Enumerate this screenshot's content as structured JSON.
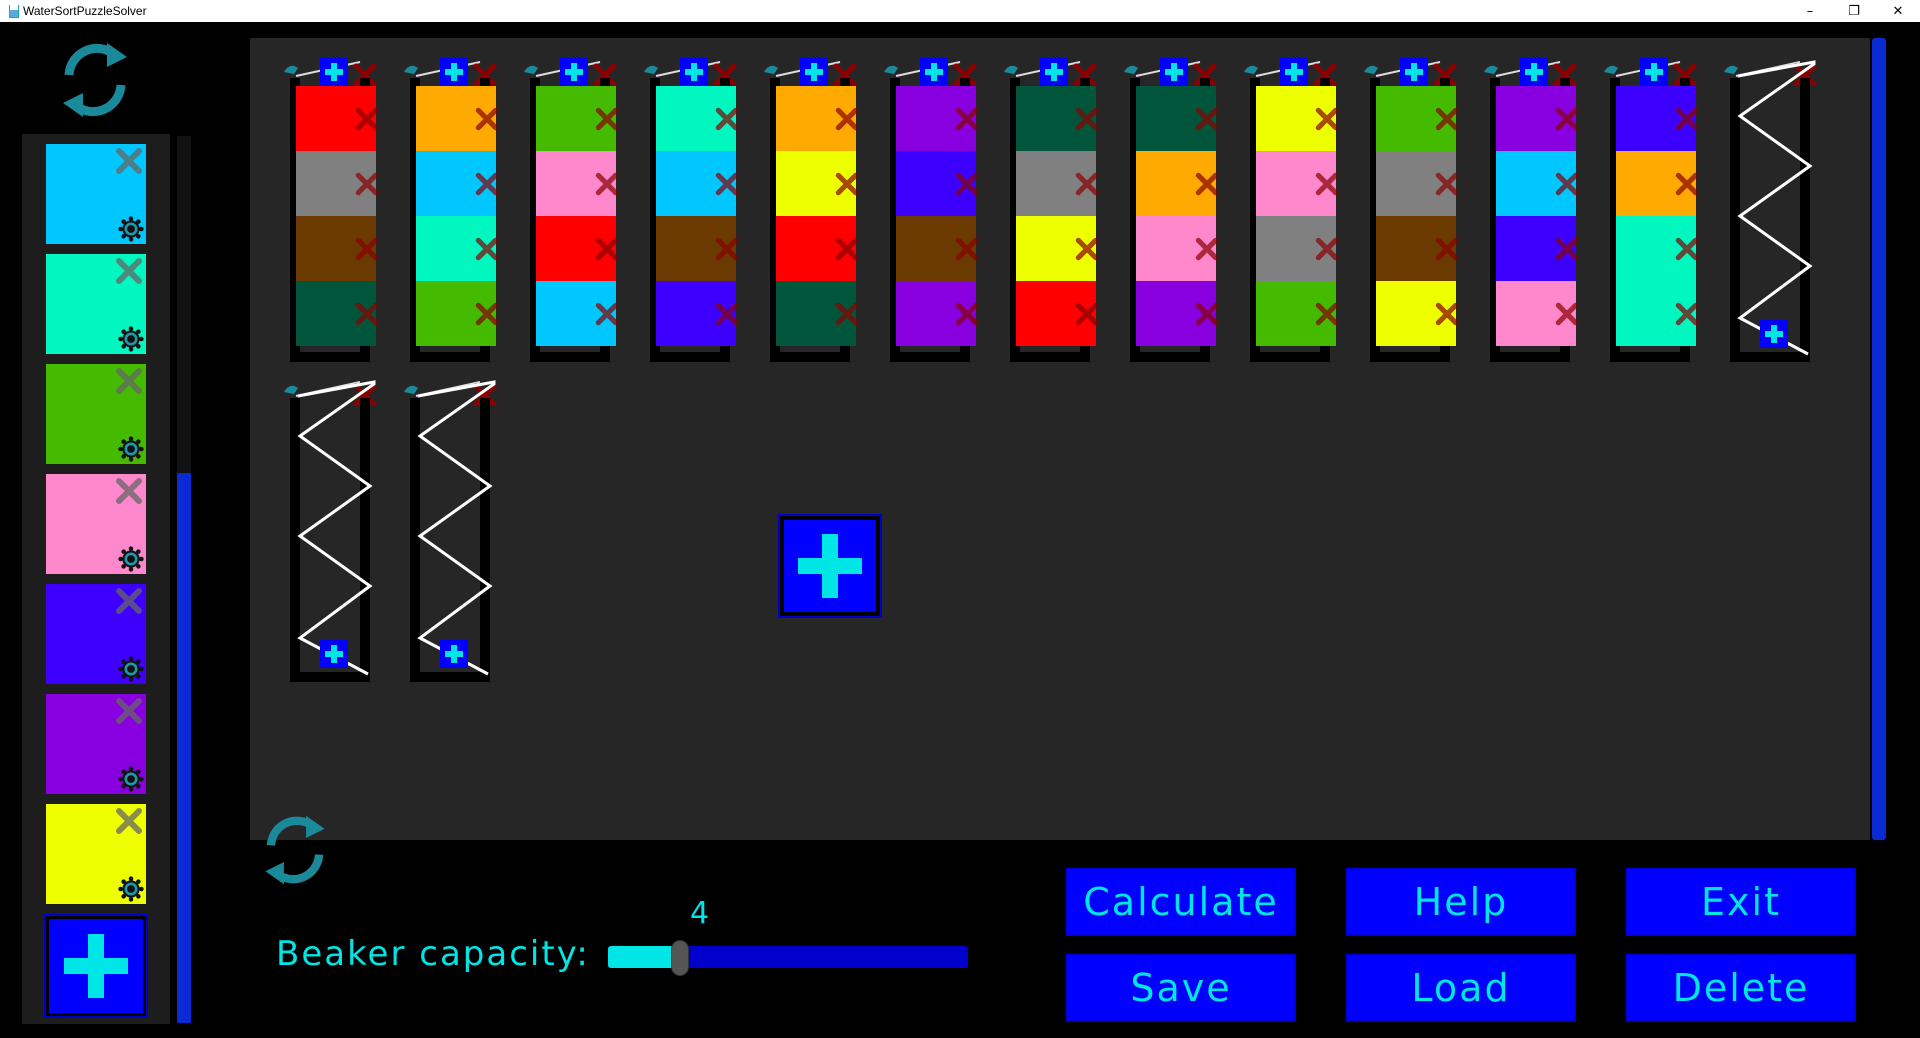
{
  "window": {
    "title": "WaterSortPuzzleSolver",
    "minimize": "–",
    "restore": "❐",
    "close": "✕"
  },
  "palette": {
    "colors": [
      "#00c7ff",
      "#00f7c0",
      "#44bb00",
      "#ff88cc",
      "#3d00ff",
      "#8800e0",
      "#eeff00"
    ],
    "add_icon": "plus-icon"
  },
  "beakers": [
    {
      "cells": [
        "#ff0000",
        "#808080",
        "#6b3a00",
        "#00553a"
      ]
    },
    {
      "cells": [
        "#ffaa00",
        "#00c7ff",
        "#00f7c0",
        "#44bb00"
      ]
    },
    {
      "cells": [
        "#44bb00",
        "#ff88cc",
        "#ff0000",
        "#00c7ff"
      ]
    },
    {
      "cells": [
        "#00f7c0",
        "#00c7ff",
        "#6b3a00",
        "#3d00ff"
      ]
    },
    {
      "cells": [
        "#ffaa00",
        "#eeff00",
        "#ff0000",
        "#00553a"
      ]
    },
    {
      "cells": [
        "#8800e0",
        "#3d00ff",
        "#6b3a00",
        "#8800e0"
      ]
    },
    {
      "cells": [
        "#00553a",
        "#808080",
        "#eeff00",
        "#ff0000"
      ]
    },
    {
      "cells": [
        "#00553a",
        "#ffaa00",
        "#ff88cc",
        "#8800e0"
      ]
    },
    {
      "cells": [
        "#eeff00",
        "#ff88cc",
        "#808080",
        "#44bb00"
      ]
    },
    {
      "cells": [
        "#44bb00",
        "#808080",
        "#6b3a00",
        "#eeff00"
      ]
    },
    {
      "cells": [
        "#8800e0",
        "#00c7ff",
        "#3d00ff",
        "#ff88cc"
      ]
    },
    {
      "cells": [
        "#3d00ff",
        "#ffaa00",
        "#00f7c0",
        "#00f7c0"
      ]
    },
    {
      "cells": []
    },
    {
      "cells": []
    },
    {
      "cells": []
    }
  ],
  "capacity": {
    "label": "Beaker capacity:",
    "value": "4",
    "min": 1,
    "max": 16,
    "current": 4
  },
  "buttons": {
    "calculate": "Calculate",
    "help": "Help",
    "exit": "Exit",
    "save": "Save",
    "load": "Load",
    "delete": "Delete"
  },
  "accent": "#00e5e5",
  "button_color": "#0000ff"
}
